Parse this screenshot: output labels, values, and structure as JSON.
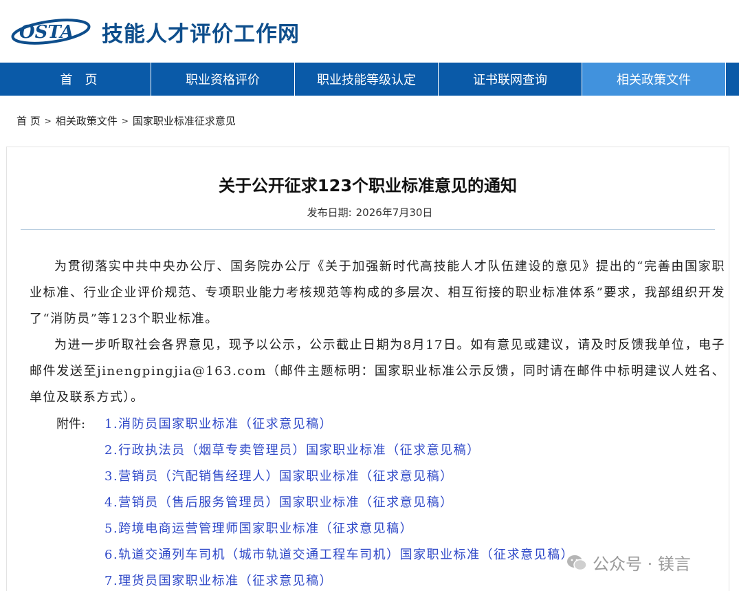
{
  "header": {
    "logo_text": "OSTA",
    "site_title": "技能人才评价工作网"
  },
  "nav": {
    "items": [
      {
        "label": "首　页"
      },
      {
        "label": "职业资格评价"
      },
      {
        "label": "职业技能等级认定"
      },
      {
        "label": "证书联网查询"
      },
      {
        "label": "相关政策文件"
      }
    ],
    "active_index": 4
  },
  "breadcrumb": {
    "items": [
      "首 页",
      "相关政策文件",
      "国家职业标准征求意见"
    ],
    "separator": ">"
  },
  "article": {
    "title": "关于公开征求123个职业标准意见的通知",
    "date_label": "发布日期:",
    "date_value": "2026年7月30日",
    "paragraph_1": "为贯彻落实中共中央办公厅、国务院办公厅《关于加强新时代高技能人才队伍建设的意见》提出的“完善由国家职业标准、行业企业评价规范、专项职业能力考核规范等构成的多层次、相互衔接的职业标准体系”要求，我部组织开发了“消防员”等123个职业标准。",
    "paragraph_2": "为进一步听取社会各界意见，现予以公示，公示截止日期为8月17日。如有意见或建议，请及时反馈我单位，电子邮件发送至jinengpingjia@163.com（邮件主题标明：国家职业标准公示反馈，同时请在邮件中标明建议人姓名、单位及联系方式）。",
    "attachments_label": "附件:",
    "attachments": [
      "1.消防员国家职业标准（征求意见稿）",
      "2.行政执法员（烟草专卖管理员）国家职业标准（征求意见稿）",
      "3.营销员（汽配销售经理人）国家职业标准（征求意见稿）",
      "4.营销员（售后服务管理员）国家职业标准（征求意见稿）",
      "5.跨境电商运营管理师国家职业标准（征求意见稿）",
      "6.轨道交通列车司机（城市轨道交通工程车司机）国家职业标准（征求意见稿）",
      "7.理货员国家职业标准（征求意见稿）"
    ]
  },
  "watermark": {
    "icon": "wechat-icon",
    "text": "公众号 · 镁言"
  },
  "colors": {
    "nav_bg": "#0a5aa8",
    "nav_active": "#4192dd",
    "title_blue": "#0e4e8c",
    "link_blue": "#2f49c8"
  }
}
